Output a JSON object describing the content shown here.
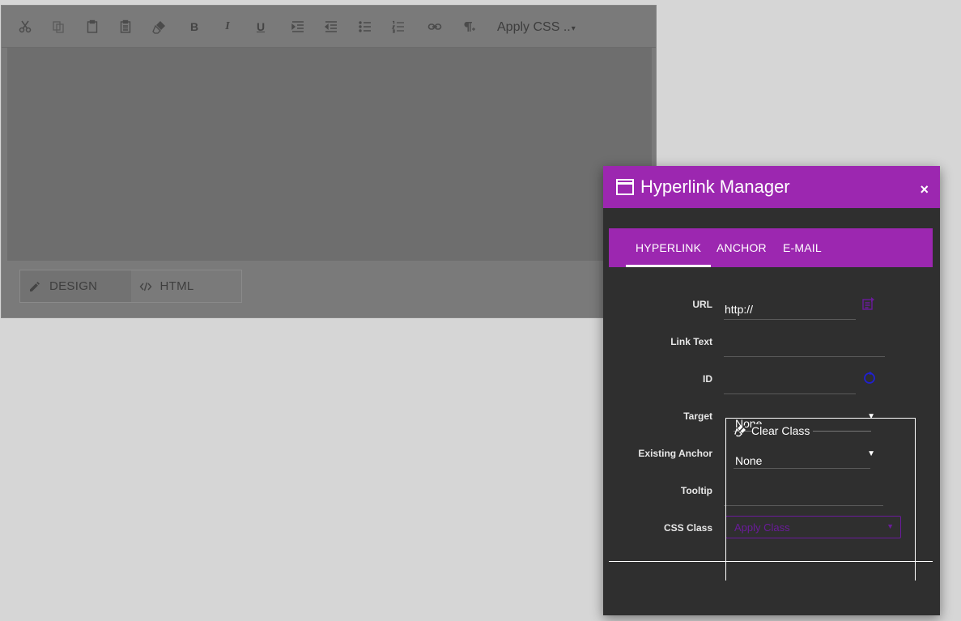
{
  "editor": {
    "toolbar": {
      "buttons": {
        "bold": "B",
        "italic": "I",
        "underline": "U"
      },
      "apply_css": "Apply CSS ..",
      "apply_css_caret": "▾"
    },
    "modes": {
      "design": "DESIGN",
      "html": "HTML"
    }
  },
  "dialog": {
    "title": "Hyperlink Manager",
    "close": "×",
    "tabs": {
      "hyperlink": "HYPERLINK",
      "anchor": "ANCHOR",
      "email": "E-MAIL"
    },
    "fields": {
      "url_label": "URL",
      "url_value": "http://",
      "link_text_label": "Link Text",
      "id_label": "ID",
      "target_label": "Target",
      "target_value": "None",
      "existing_anchor_label": "Existing Anchor",
      "existing_anchor_value": "None",
      "tooltip_label": "Tooltip",
      "css_class_label": "CSS Class",
      "css_class_value": "Apply Class"
    },
    "dropdown": {
      "clear_class": "Clear Class"
    }
  },
  "colors": {
    "accent": "#9c27b0",
    "dialog_bg": "#2f2f2f",
    "page_bg": "#d6d6d6"
  }
}
